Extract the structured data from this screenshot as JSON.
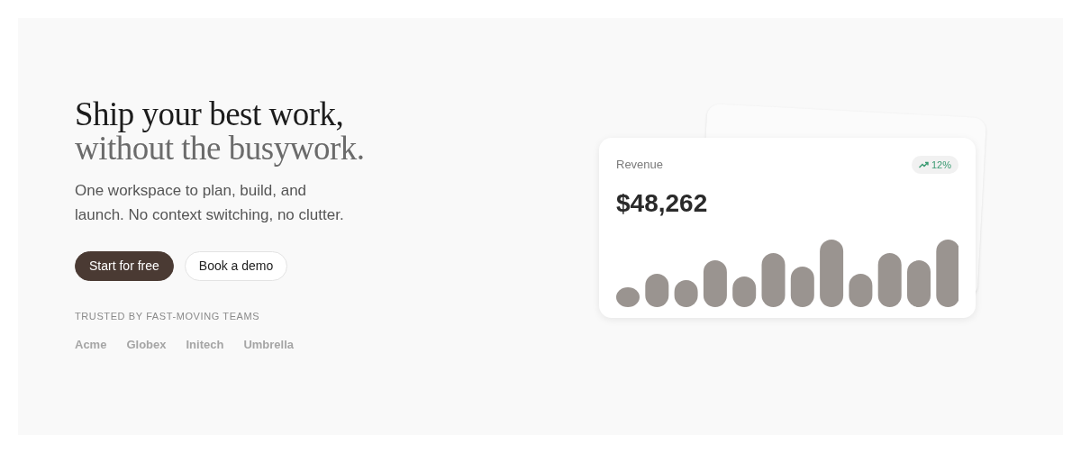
{
  "hero": {
    "title_line_1": "Ship your best work,",
    "title_line_2": "without the busywork.",
    "subtitle": "One workspace to plan, build, and launch. No context switching, no clutter.",
    "buttons": [
      {
        "label": "Start for free",
        "kind": "primary"
      },
      {
        "label": "Book a demo",
        "kind": "secondary"
      }
    ],
    "trusted_label": "TRUSTED BY FAST-MOVING TEAMS",
    "logos": [
      "Acme",
      "Globex",
      "Initech",
      "Umbrella"
    ]
  },
  "card": {
    "label": "Revenue",
    "change": "12%",
    "value": "$48,262"
  }
}
